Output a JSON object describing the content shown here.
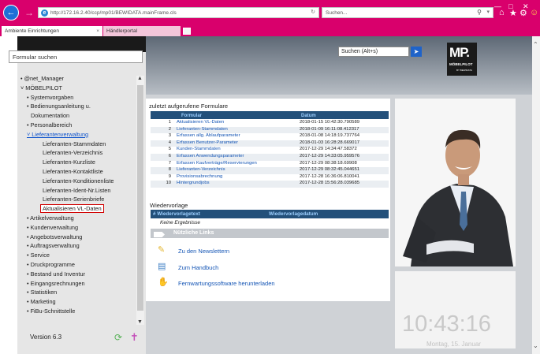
{
  "browser": {
    "url": "http://172.16.2.40/ccp/mp01/BEWIDATA.mainFrame.cls",
    "search_placeholder": "Suchen...",
    "tabs": [
      {
        "label": "Ambiente Einrichtungen"
      },
      {
        "label": "Händlerportal"
      }
    ]
  },
  "sidebar": {
    "search_label": "Formular suchen",
    "items": [
      {
        "label": "• @net_Manager"
      },
      {
        "label": "˅ MÖBELPILOT"
      },
      {
        "label": "• Systemvorgaben"
      },
      {
        "label": "• Bedienungsanleitung u."
      },
      {
        "label": "Dokumentation"
      },
      {
        "label": "• Personalbereich"
      },
      {
        "label": "˅ Lieferantenverwaltung"
      },
      {
        "label": "Lieferanten-Stammdaten"
      },
      {
        "label": "Lieferanten-Verzeichnis"
      },
      {
        "label": "Lieferanten-Kurzliste"
      },
      {
        "label": "Lieferanten-Kontaktliste"
      },
      {
        "label": "Lieferanten-Konditionenliste"
      },
      {
        "label": "Lieferanten-Ident-Nr.Listen"
      },
      {
        "label": "Lieferanten-Serienbriefe"
      },
      {
        "label": "Aktualisieren VL-Daten"
      },
      {
        "label": "• Artikelverwaltung"
      },
      {
        "label": "• Kundenverwaltung"
      },
      {
        "label": "• Angebotsverwaltung"
      },
      {
        "label": "• Auftragsverwaltung"
      },
      {
        "label": "• Service"
      },
      {
        "label": "• Druckprogramme"
      },
      {
        "label": "• Bestand und Inventur"
      },
      {
        "label": "• Eingangsrechnungen"
      },
      {
        "label": "• Statistiken"
      },
      {
        "label": "• Marketing"
      },
      {
        "label": "• FiBu-Schnittstelle"
      }
    ],
    "version": "Version 6.3"
  },
  "portal": {
    "search_value": "Suchen (Alt+s)",
    "logo_text": "MP.",
    "logo_brand": "MÖBELPILOT",
    "logo_sub": "BY BEWIDATA"
  },
  "recent": {
    "title": "zuletzt aufgerufene Formulare",
    "col_form": "Formular",
    "col_date": "Datum",
    "rows": [
      {
        "num": "1",
        "name": "Aktualisieren VL-Daten",
        "date": "2018-01-15 10:42:30.790589"
      },
      {
        "num": "2",
        "name": "Lieferanten-Stammdaten",
        "date": "2018-01-09 16:11:08.412317"
      },
      {
        "num": "3",
        "name": "Erfassen allg. Ablaufparameter",
        "date": "2018-01-08 14:18:19.737764"
      },
      {
        "num": "4",
        "name": "Erfassen Benutzer-Parameter",
        "date": "2018-01-03 16:28:28.669017"
      },
      {
        "num": "5",
        "name": "Kunden-Stammdaten",
        "date": "2017-12-29 14:34:47.58372"
      },
      {
        "num": "6",
        "name": "Erfassen Anwendungsparameter",
        "date": "2017-12-29 14:33:05.959576"
      },
      {
        "num": "7",
        "name": "Erfassen Kaufverträge/Reservierungen",
        "date": "2017-12-29 08:38:18.69908"
      },
      {
        "num": "8",
        "name": "Lieferanten-Verzeichnis",
        "date": "2017-12-29 08:32:45.044651"
      },
      {
        "num": "9",
        "name": "Provisionsabrechnung",
        "date": "2017-12-28 16:36:06.810041"
      },
      {
        "num": "10",
        "name": "Hintergrundjobs",
        "date": "2017-12-28 15:56:28.039685"
      }
    ]
  },
  "resubmission": {
    "title": "Wiedervorlage",
    "col_text": "# Wiedervorlagetext",
    "col_date": "Wiedervorlagedatum",
    "empty": "Keine Ergebnisse"
  },
  "useful_links": {
    "title": "Nützliche Links",
    "items": [
      {
        "label": "Zu den Newslettern",
        "icon": "newsletter-icon"
      },
      {
        "label": "Zum Handbuch",
        "icon": "book-icon"
      },
      {
        "label": "Fernwartungssoftware herunterladen",
        "icon": "remote-icon"
      }
    ]
  },
  "clock": {
    "time": "10:43:16",
    "date": "Montag, 15. Januar"
  },
  "colors": {
    "browser_accent": "#d9006c",
    "table_header": "#23507a",
    "link": "#1455b5",
    "highlight_border": "#d00000"
  }
}
